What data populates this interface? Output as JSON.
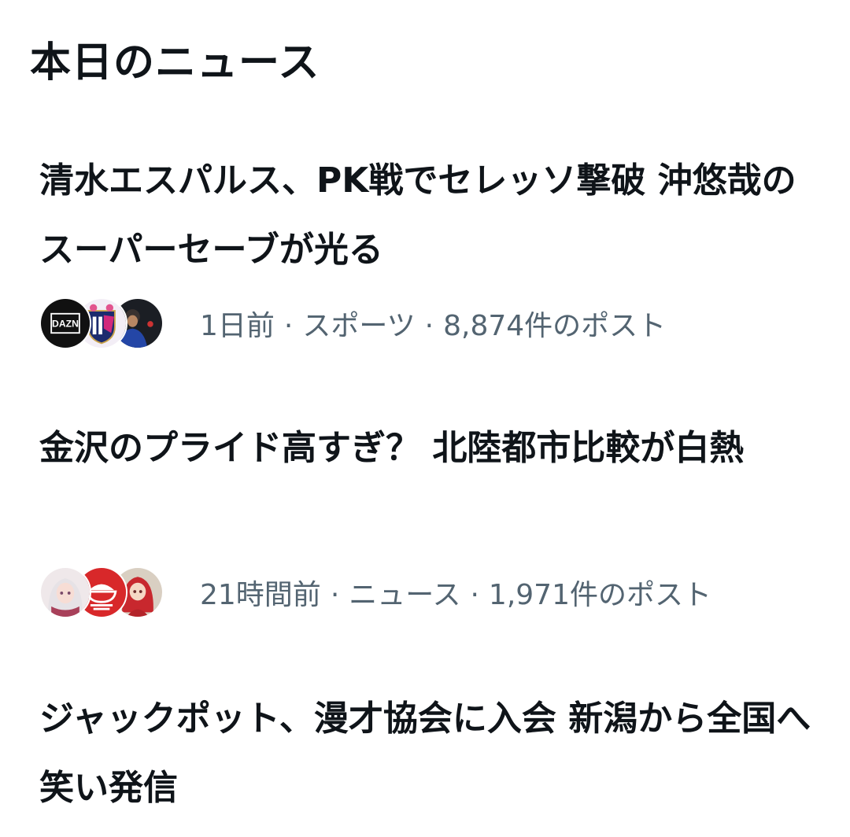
{
  "section": {
    "title": "本日のニュース"
  },
  "news": [
    {
      "headline": "清水エスパルス、PK戦でセレッソ撃破 沖悠哉のスーパーセーブが光る",
      "time": "1日前",
      "category": "スポーツ",
      "posts": "8,874件のポスト",
      "avatars": [
        {
          "kind": "dazn-logo",
          "text": "DAZN"
        },
        {
          "kind": "cerezo-crest"
        },
        {
          "kind": "person-photo"
        }
      ]
    },
    {
      "headline": "金沢のプライド高すぎ？ 北陸都市比較が白熱",
      "time": "21時間前",
      "category": "ニュース",
      "posts": "1,971件のポスト",
      "avatars": [
        {
          "kind": "anime-illustration"
        },
        {
          "kind": "red-rice-bowl-logo"
        },
        {
          "kind": "anime-red-hair"
        }
      ]
    },
    {
      "headline": "ジャックポット、漫才協会に入会 新潟から全国へ笑い発信"
    }
  ],
  "colors": {
    "text_primary": "#0f1419",
    "text_secondary": "#536471",
    "background": "#ffffff"
  },
  "separator": "·"
}
